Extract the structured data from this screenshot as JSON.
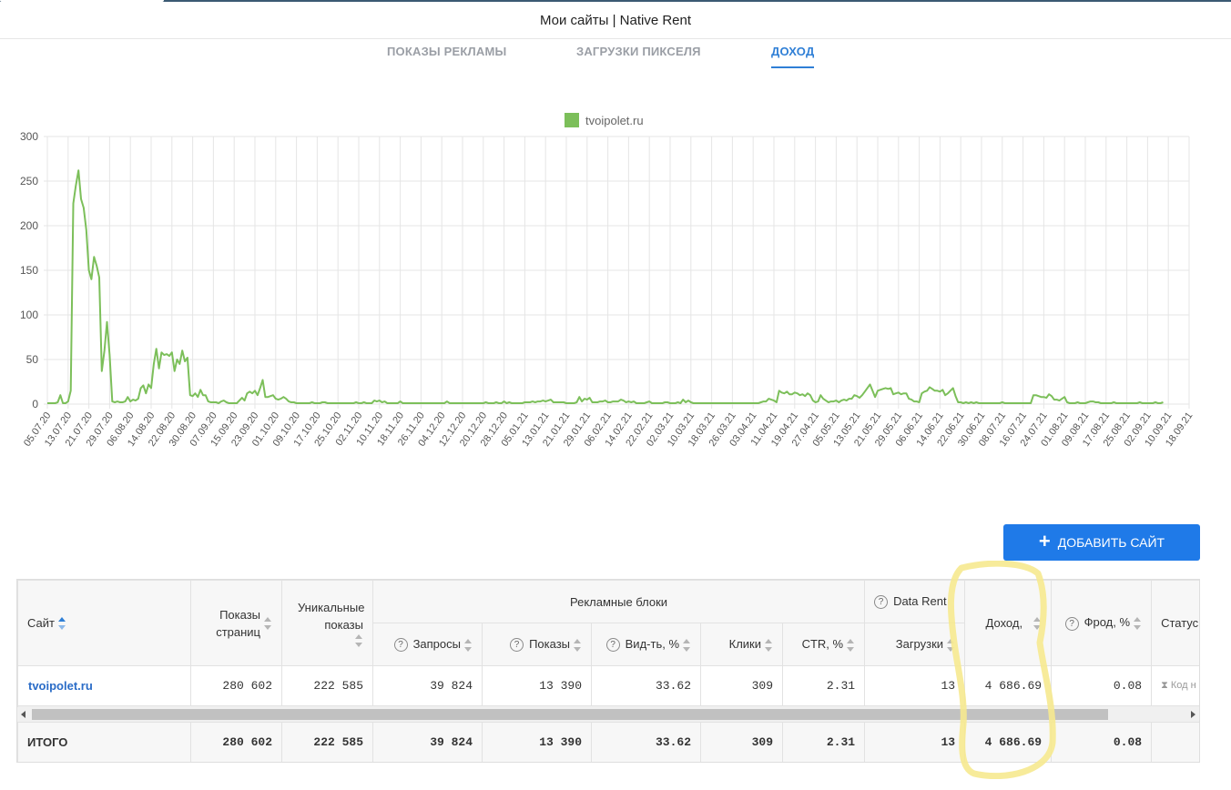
{
  "page": {
    "title": "Мои сайты | Native Rent"
  },
  "tabs": [
    {
      "label": "ПОКАЗЫ РЕКЛАМЫ",
      "active": false
    },
    {
      "label": "ЗАГРУЗКИ ПИКСЕЛЯ",
      "active": false
    },
    {
      "label": "ДОХОД",
      "active": true
    }
  ],
  "chart_data": {
    "type": "line",
    "legend_position": "top-center",
    "grid": true,
    "ylim": [
      0,
      300
    ],
    "yticks": [
      0,
      50,
      100,
      150,
      200,
      250,
      300
    ],
    "xticks": [
      "05.07.20",
      "13.07.20",
      "21.07.20",
      "29.07.20",
      "06.08.20",
      "14.08.20",
      "22.08.20",
      "30.08.20",
      "07.09.20",
      "15.09.20",
      "23.09.20",
      "01.10.20",
      "09.10.20",
      "17.10.20",
      "25.10.20",
      "02.11.20",
      "10.11.20",
      "18.11.20",
      "26.11.20",
      "04.12.20",
      "12.12.20",
      "20.12.20",
      "28.12.20",
      "05.01.21",
      "13.01.21",
      "21.01.21",
      "29.01.21",
      "06.02.21",
      "14.02.21",
      "22.02.21",
      "02.03.21",
      "10.03.21",
      "18.03.21",
      "26.03.21",
      "03.04.21",
      "11.04.21",
      "19.04.21",
      "27.04.21",
      "05.05.21",
      "13.05.21",
      "21.05.21",
      "29.05.21",
      "06.06.21",
      "14.06.21",
      "22.06.21",
      "30.06.21",
      "08.07.21",
      "16.07.21",
      "24.07.21",
      "01.08.21",
      "09.08.21",
      "17.08.21",
      "25.08.21",
      "02.09.21",
      "10.09.21",
      "18.09.21"
    ],
    "series": [
      {
        "name": "tvoipolet.ru",
        "color": "#7cbf5a",
        "start_date": "05.07.20",
        "step_days": 1,
        "values": [
          1,
          1,
          1,
          1,
          2,
          10,
          1,
          1,
          3,
          15,
          225,
          245,
          262,
          230,
          220,
          195,
          150,
          140,
          165,
          155,
          142,
          37,
          60,
          92,
          55,
          3,
          2,
          3,
          2,
          2,
          3,
          8,
          3,
          5,
          4,
          6,
          18,
          21,
          12,
          22,
          18,
          45,
          62,
          40,
          58,
          55,
          56,
          54,
          58,
          37,
          50,
          45,
          60,
          48,
          52,
          10,
          9,
          12,
          8,
          16,
          10,
          10,
          3,
          2,
          2,
          2,
          1,
          3,
          4,
          2,
          1,
          1,
          1,
          1,
          4,
          7,
          4,
          12,
          14,
          12,
          15,
          10,
          18,
          27,
          8,
          8,
          9,
          10,
          6,
          5,
          6,
          8,
          6,
          3,
          2,
          2,
          1,
          1,
          1,
          1,
          1,
          1,
          2,
          1,
          1,
          1,
          2,
          2,
          1,
          1,
          1,
          1,
          1,
          1,
          1,
          1,
          1,
          1,
          1,
          2,
          1,
          1,
          2,
          1,
          1,
          1,
          4,
          3,
          4,
          2,
          3,
          1,
          1,
          1,
          1,
          1,
          3,
          1,
          1,
          1,
          1,
          1,
          1,
          1,
          1,
          1,
          1,
          1,
          1,
          1,
          1,
          1,
          1,
          1,
          3,
          1,
          1,
          1,
          1,
          1,
          1,
          1,
          1,
          1,
          1,
          1,
          1,
          1,
          1,
          2,
          1,
          1,
          1,
          2,
          1,
          1,
          3,
          1,
          2,
          1,
          1,
          1,
          1,
          1,
          2,
          2,
          2,
          3,
          2,
          3,
          3,
          4,
          3,
          4,
          5,
          2,
          2,
          2,
          2,
          2,
          1,
          1,
          1,
          1,
          2,
          8,
          3,
          6,
          5,
          7,
          2,
          2,
          2,
          3,
          3,
          4,
          2,
          2,
          3,
          3,
          3,
          5,
          4,
          2,
          3,
          2,
          3,
          1,
          1,
          1,
          1,
          2,
          3,
          1,
          1,
          1,
          1,
          1,
          2,
          2,
          1,
          1,
          1,
          2,
          1,
          5,
          2,
          4,
          2,
          1,
          1,
          1,
          1,
          1,
          1,
          1,
          1,
          1,
          1,
          1,
          1,
          1,
          1,
          1,
          1,
          1,
          1,
          1,
          1,
          1,
          1,
          1,
          1,
          1,
          1,
          2,
          3,
          3,
          6,
          5,
          4,
          2,
          15,
          13,
          12,
          14,
          11,
          11,
          13,
          12,
          10,
          11,
          9,
          12,
          10,
          4,
          2,
          3,
          10,
          6,
          4,
          2,
          3,
          3,
          4,
          2,
          4,
          5,
          4,
          6,
          6,
          10,
          9,
          7,
          10,
          14,
          18,
          22,
          15,
          8,
          15,
          16,
          17,
          18,
          17,
          18,
          11,
          12,
          13,
          11,
          12,
          12,
          6,
          5,
          3,
          3,
          2,
          12,
          14,
          15,
          19,
          17,
          15,
          15,
          14,
          16,
          10,
          12,
          15,
          18,
          9,
          2,
          2,
          1,
          2,
          1,
          2,
          1,
          2,
          1,
          1,
          1,
          1,
          1,
          1,
          1,
          1,
          1,
          2,
          1,
          1,
          1,
          1,
          1,
          1,
          1,
          1,
          1,
          1,
          1,
          10,
          10,
          9,
          8,
          8,
          7,
          11,
          9,
          5,
          5,
          4,
          6,
          8,
          2,
          1,
          1,
          1,
          2,
          1,
          1,
          1,
          2,
          3,
          3,
          2,
          2,
          1,
          1,
          1,
          1,
          1,
          2,
          1,
          1,
          1,
          1,
          1,
          1,
          1,
          1,
          1,
          2,
          1,
          1,
          1,
          1,
          1,
          2,
          1,
          1,
          2
        ]
      }
    ]
  },
  "add_button": {
    "label": "ДОБАВИТЬ САЙТ"
  },
  "table": {
    "headers": {
      "site": "Сайт",
      "page_views": "Показы страниц",
      "unique_views": "Уникальные показы",
      "ad_blocks": "Рекламные блоки",
      "requests": "Запросы",
      "impressions": "Показы",
      "viewability": "Вид-ть, %",
      "clicks": "Клики",
      "ctr": "CTR, %",
      "data_rent": "Data Rent",
      "loads": "Загрузки",
      "income": "Доход,",
      "fraud": "Фрод, %",
      "status": "Статус"
    },
    "rows": [
      {
        "site": "tvoipolet.ru",
        "page_views": "280 602",
        "unique_views": "222 585",
        "requests": "39 824",
        "impressions": "13 390",
        "viewability": "33.62",
        "clicks": "309",
        "ctr": "2.31",
        "loads": "13",
        "income": "4 686.69",
        "fraud": "0.08",
        "status": "Код н"
      }
    ],
    "total": {
      "label": "ИТОГО",
      "page_views": "280 602",
      "unique_views": "222 585",
      "requests": "39 824",
      "impressions": "13 390",
      "viewability": "33.62",
      "clicks": "309",
      "ctr": "2.31",
      "loads": "13",
      "income": "4 686.69",
      "fraud": "0.08"
    }
  }
}
